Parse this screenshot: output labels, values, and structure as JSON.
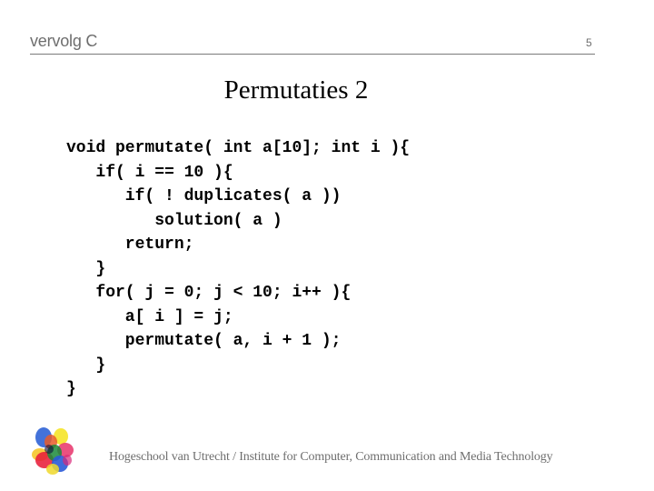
{
  "header": {
    "label": "vervolg C",
    "page_number": "5"
  },
  "slide": {
    "title": "Permutaties 2",
    "code_lines": [
      "void permutate( int a[10]; int i ){",
      "   if( i == 10 ){",
      "      if( ! duplicates( a ))",
      "         solution( a )",
      "      return;",
      "   }",
      "   for( j = 0; j < 10; i++ ){",
      "      a[ i ] = j;",
      "      permutate( a, i + 1 );",
      "   }",
      "}"
    ]
  },
  "footer": {
    "logo_icon": "colorful-handprint-logo",
    "text": "Hogeschool van Utrecht / Institute for Computer, Communication and Media Technology"
  },
  "colors": {
    "header_text": "#6e6e6e",
    "rule": "#7a7a7a",
    "title_text": "#000000",
    "code_text": "#000000",
    "footer_text": "#6e6e6e"
  }
}
